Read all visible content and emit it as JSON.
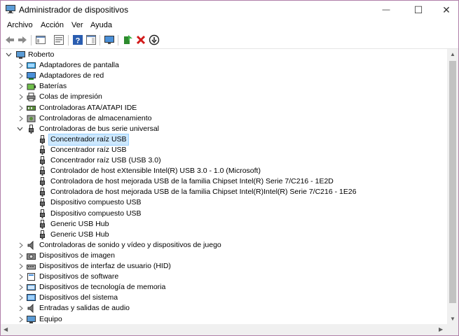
{
  "window": {
    "title": "Administrador de dispositivos",
    "controls": {
      "minimize": "—",
      "maximize": "☐",
      "close": "✕"
    }
  },
  "menu": [
    "Archivo",
    "Acción",
    "Ver",
    "Ayuda"
  ],
  "toolbar": {
    "icons": [
      "back-icon",
      "forward-icon",
      "show-hide-tree-icon",
      "properties-icon",
      "help-icon",
      "action-pane-icon",
      "monitor-icon",
      "update-driver-icon",
      "uninstall-icon",
      "disable-device-icon"
    ]
  },
  "tree": {
    "root": "Roberto",
    "rows": [
      {
        "label": "Adaptadores de pantalla",
        "level": 1,
        "expand": "collapsed",
        "icon": "display-adapter-icon",
        "selected": false
      },
      {
        "label": "Adaptadores de red",
        "level": 1,
        "expand": "collapsed",
        "icon": "network-adapter-icon",
        "selected": false
      },
      {
        "label": "Baterías",
        "level": 1,
        "expand": "collapsed",
        "icon": "battery-icon",
        "selected": false
      },
      {
        "label": "Colas de impresión",
        "level": 1,
        "expand": "collapsed",
        "icon": "printer-icon",
        "selected": false
      },
      {
        "label": "Controladoras ATA/ATAPI IDE",
        "level": 1,
        "expand": "collapsed",
        "icon": "ide-controller-icon",
        "selected": false
      },
      {
        "label": "Controladoras de almacenamiento",
        "level": 1,
        "expand": "collapsed",
        "icon": "storage-controller-icon",
        "selected": false
      },
      {
        "label": "Controladoras de bus serie universal",
        "level": 1,
        "expand": "expanded",
        "icon": "usb-icon",
        "selected": false
      },
      {
        "label": "Concentrador raíz USB",
        "level": 2,
        "expand": "none",
        "icon": "usb-icon",
        "selected": true
      },
      {
        "label": "Concentrador raíz USB",
        "level": 2,
        "expand": "none",
        "icon": "usb-icon",
        "selected": false
      },
      {
        "label": "Concentrador raíz USB (USB 3.0)",
        "level": 2,
        "expand": "none",
        "icon": "usb-icon",
        "selected": false
      },
      {
        "label": "Controlador de host eXtensible Intel(R) USB 3.0 - 1.0 (Microsoft)",
        "level": 2,
        "expand": "none",
        "icon": "usb-icon",
        "selected": false
      },
      {
        "label": "Controladora de host mejorada USB de la familia Chipset Intel(R) Serie 7/C216 - 1E2D",
        "level": 2,
        "expand": "none",
        "icon": "usb-icon",
        "selected": false
      },
      {
        "label": "Controladora de host mejorada USB de la familia Chipset Intel(R)Intel(R) Serie 7/C216 - 1E26",
        "level": 2,
        "expand": "none",
        "icon": "usb-icon",
        "selected": false
      },
      {
        "label": "Dispositivo compuesto USB",
        "level": 2,
        "expand": "none",
        "icon": "usb-icon",
        "selected": false
      },
      {
        "label": "Dispositivo compuesto USB",
        "level": 2,
        "expand": "none",
        "icon": "usb-icon",
        "selected": false
      },
      {
        "label": "Generic USB Hub",
        "level": 2,
        "expand": "none",
        "icon": "usb-icon",
        "selected": false
      },
      {
        "label": "Generic USB Hub",
        "level": 2,
        "expand": "none",
        "icon": "usb-icon",
        "selected": false
      },
      {
        "label": "Controladoras de sonido y vídeo y dispositivos de juego",
        "level": 1,
        "expand": "collapsed",
        "icon": "speaker-icon",
        "selected": false
      },
      {
        "label": "Dispositivos de imagen",
        "level": 1,
        "expand": "collapsed",
        "icon": "camera-icon",
        "selected": false
      },
      {
        "label": "Dispositivos de interfaz de usuario (HID)",
        "level": 1,
        "expand": "collapsed",
        "icon": "hid-icon",
        "selected": false
      },
      {
        "label": "Dispositivos de software",
        "level": 1,
        "expand": "collapsed",
        "icon": "software-device-icon",
        "selected": false
      },
      {
        "label": "Dispositivos de tecnología de memoria",
        "level": 1,
        "expand": "collapsed",
        "icon": "memory-device-icon",
        "selected": false
      },
      {
        "label": "Dispositivos del sistema",
        "level": 1,
        "expand": "collapsed",
        "icon": "system-device-icon",
        "selected": false
      },
      {
        "label": "Entradas y salidas de audio",
        "level": 1,
        "expand": "collapsed",
        "icon": "speaker-icon",
        "selected": false
      },
      {
        "label": "Equipo",
        "level": 1,
        "expand": "collapsed",
        "icon": "computer-icon",
        "selected": false
      }
    ]
  },
  "colors": {
    "selection": "#cce8ff",
    "selection_border": "#99d1ff",
    "window_border": "#b07fa8"
  }
}
